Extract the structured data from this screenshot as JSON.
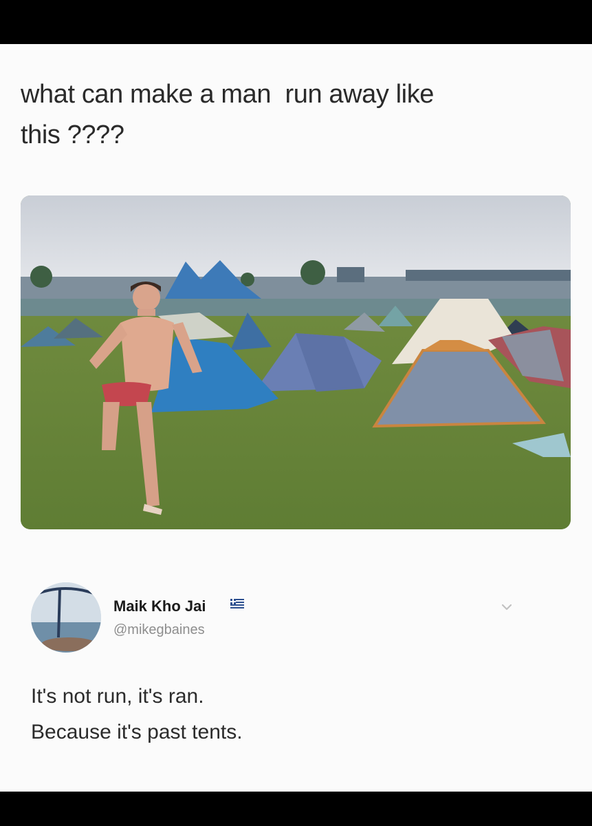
{
  "post": {
    "caption": "what can make a man  run away like\nthis ????",
    "photo_icon": "festival-campsite-photo"
  },
  "reply": {
    "display_name": "Maik Kho Jai",
    "handle": "@mikegbaines",
    "flag_icon": "greek-flag-icon",
    "menu_icon": "chevron-down-icon",
    "lines": [
      "It's not run, it's ran.",
      "Because it's past tents."
    ]
  },
  "colors": {
    "background": "#000000",
    "card": "#fbfbfb",
    "text": "#2a2a2a",
    "handle": "#8e8e8e"
  }
}
